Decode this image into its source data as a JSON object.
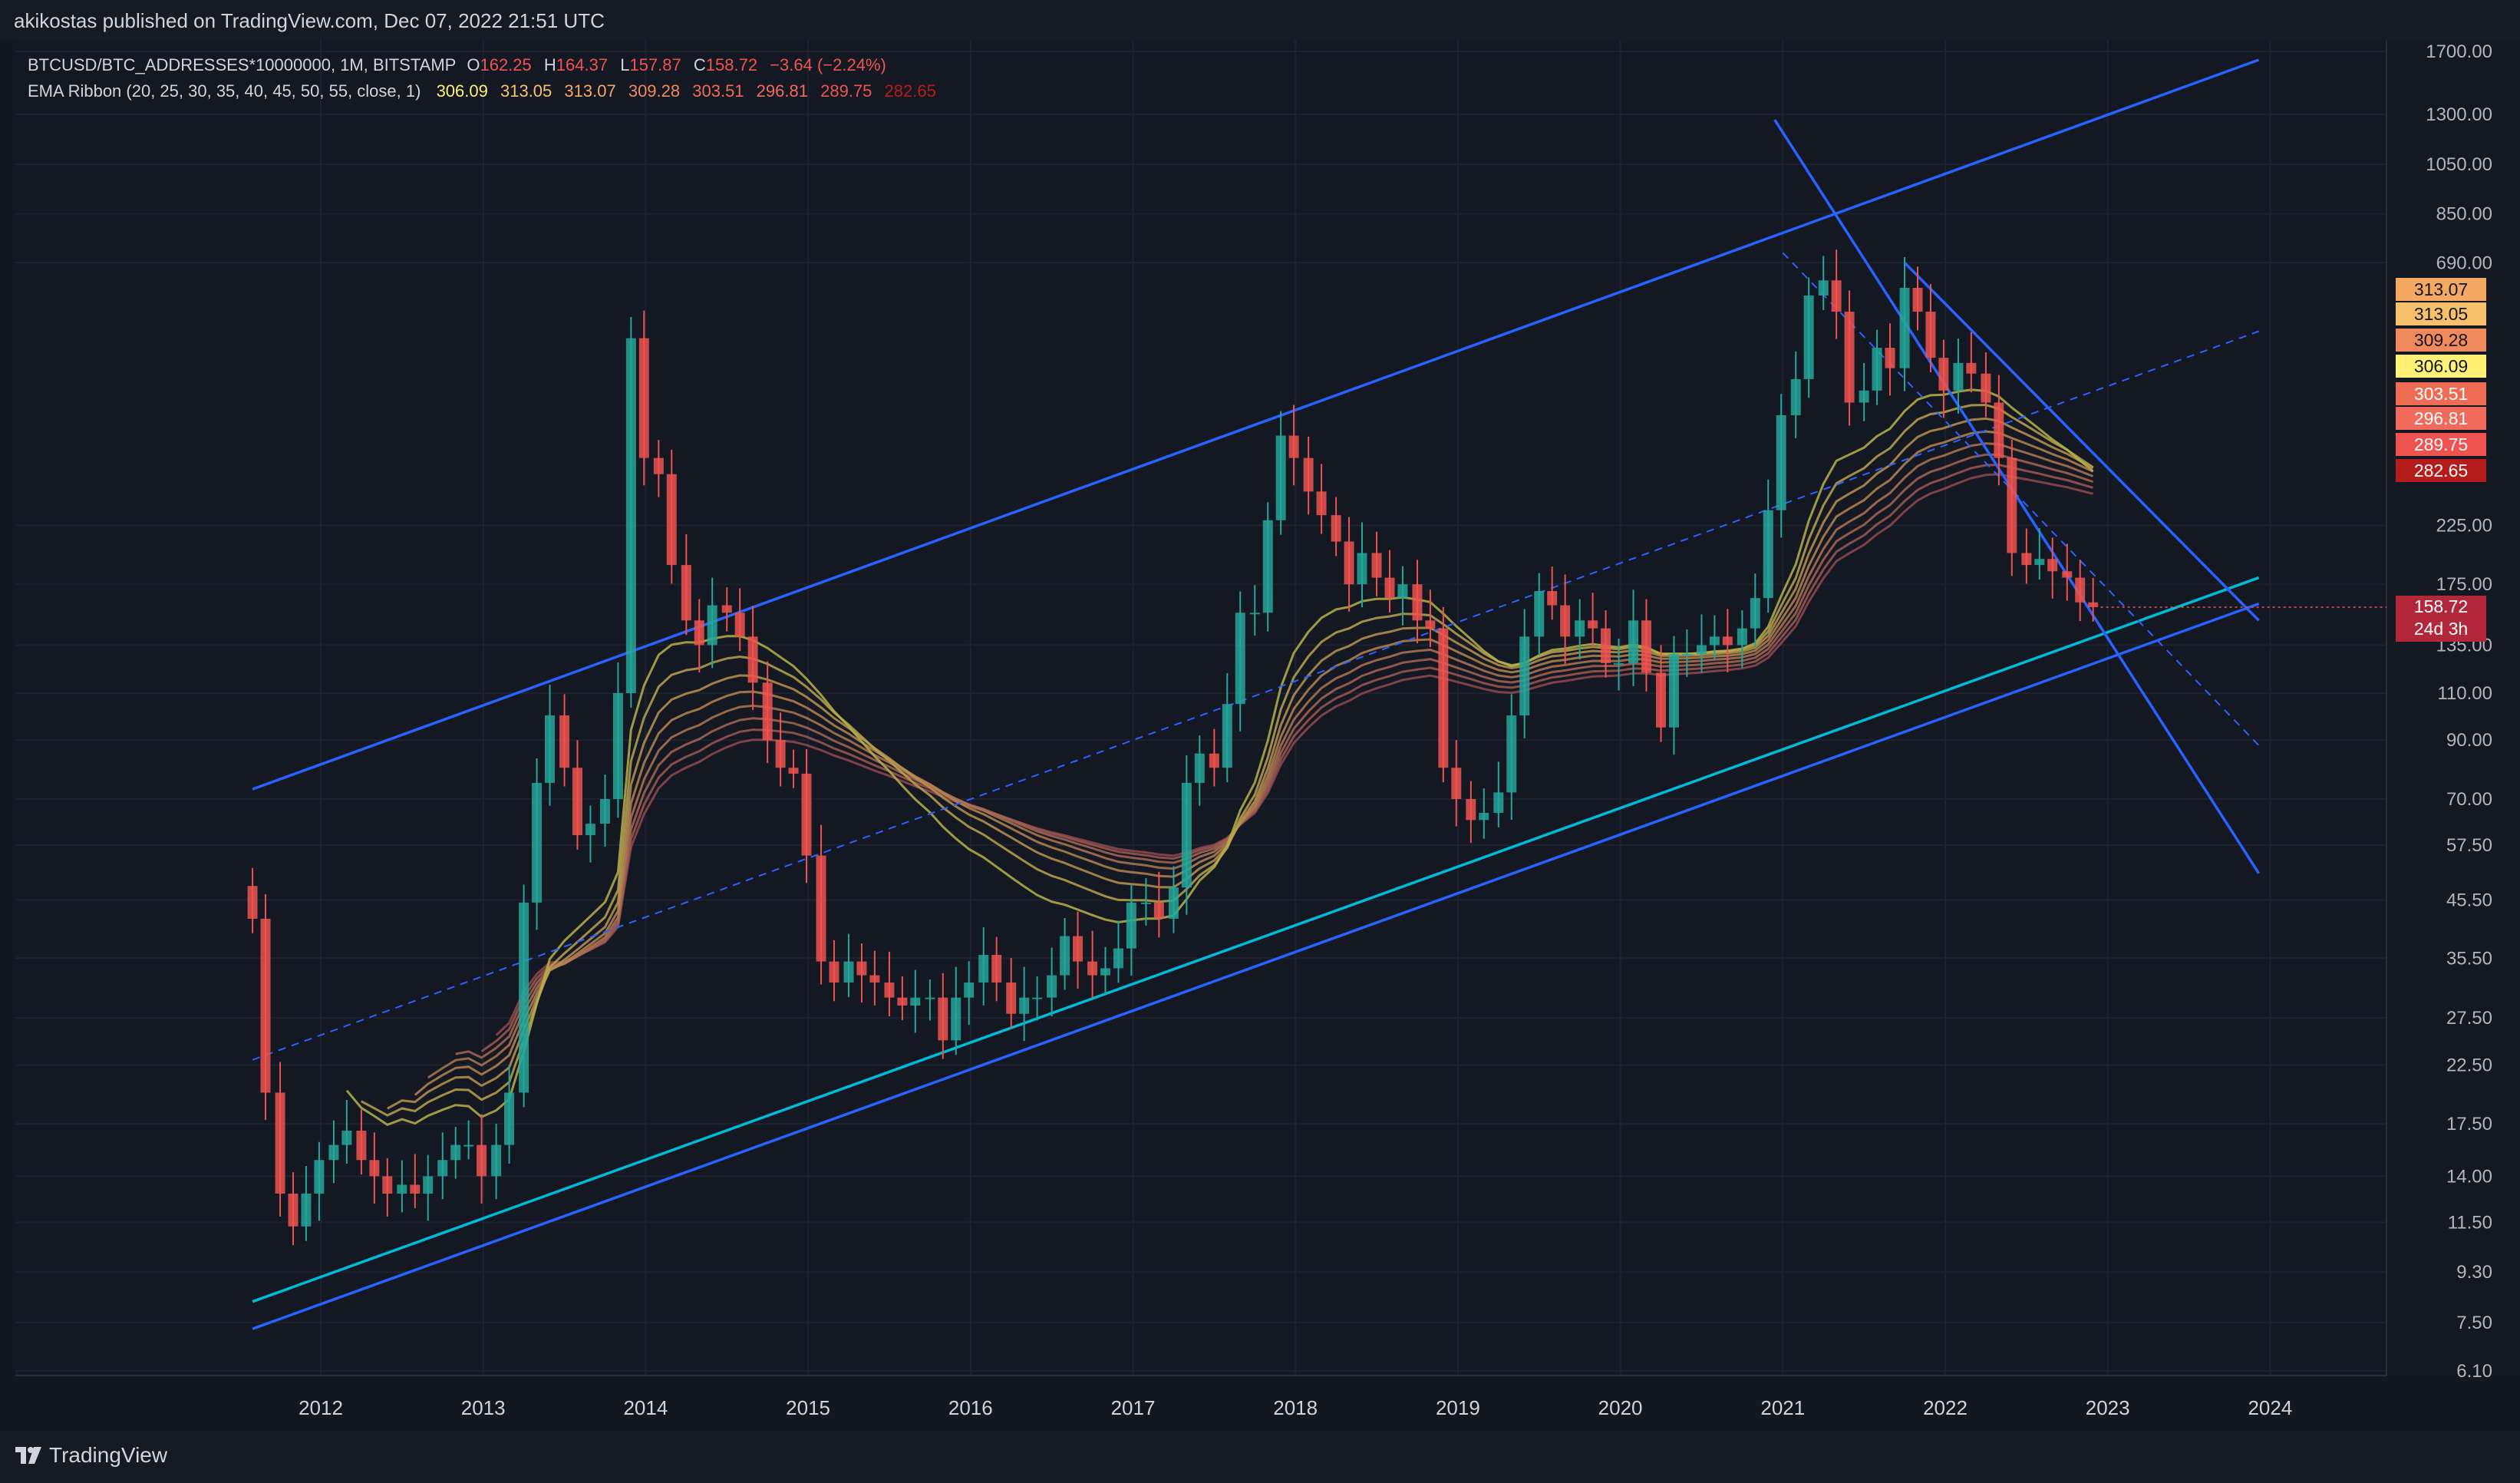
{
  "header": {
    "publisher": "akikostas published on TradingView.com, Dec 07, 2022 21:51 UTC"
  },
  "legend": {
    "symbol": "BTCUSD/BTC_ADDRESSES*10000000, 1M, BITSTAMP",
    "o_label": "O",
    "o_value": "162.25",
    "h_label": "H",
    "h_value": "164.37",
    "l_label": "L",
    "l_value": "157.87",
    "c_label": "C",
    "c_value": "158.72",
    "change": "−3.64 (−2.24%)",
    "ema_label": "EMA Ribbon (20, 25, 30, 35, 40, 45, 50, 55, close, 1)",
    "ema_values": [
      "306.09",
      "313.05",
      "313.07",
      "309.28",
      "303.51",
      "296.81",
      "289.75",
      "282.65"
    ]
  },
  "price_tags": [
    {
      "text": "313.07",
      "bg": "#f5a862",
      "fg": "#131722"
    },
    {
      "text": "313.05",
      "bg": "#f7c06a",
      "fg": "#131722"
    },
    {
      "text": "309.28",
      "bg": "#f08a5d",
      "fg": "#131722"
    },
    {
      "text": "306.09",
      "bg": "#fff176",
      "fg": "#131722"
    },
    {
      "text": "303.51",
      "bg": "#ef6c54",
      "fg": "#ffffff"
    },
    {
      "text": "296.81",
      "bg": "#f26a5c",
      "fg": "#ffffff"
    },
    {
      "text": "289.75",
      "bg": "#ef5350",
      "fg": "#ffffff"
    },
    {
      "text": "282.65",
      "bg": "#b71c1c",
      "fg": "#ffffff"
    }
  ],
  "last_price": {
    "text": "158.72",
    "countdown": "24d 3h",
    "bg": "#ef5350"
  },
  "colors": {
    "background": "#141823",
    "up": "#26a69a",
    "down": "#ef5350",
    "channel": "#2962ff",
    "support": "#00bcd4",
    "grid": "#1e2230"
  },
  "footer": {
    "brand": "TradingView"
  },
  "chart_data": {
    "type": "candlestick",
    "scale": "log",
    "ylim": [
      5.6,
      1780
    ],
    "xlim": [
      2011.0,
      2024.6
    ],
    "y_ticks": [
      "1700.00",
      "1300.00",
      "1050.00",
      "850.00",
      "690.00",
      "225.00",
      "175.00",
      "135.00",
      "110.00",
      "90.00",
      "70.00",
      "57.50",
      "45.50",
      "35.50",
      "27.50",
      "22.50",
      "17.50",
      "14.00",
      "11.50",
      "9.30",
      "7.50",
      "6.10"
    ],
    "x_ticks": [
      "2012",
      "2013",
      "2014",
      "2015",
      "2016",
      "2017",
      "2018",
      "2019",
      "2020",
      "2021",
      "2022",
      "2023",
      "2024"
    ],
    "grid": true,
    "closes": [
      [
        2011.58,
        42
      ],
      [
        2011.66,
        20
      ],
      [
        2011.75,
        13
      ],
      [
        2011.83,
        11.3
      ],
      [
        2011.91,
        13
      ],
      [
        2011.99,
        15
      ],
      [
        2012.08,
        16
      ],
      [
        2012.16,
        17
      ],
      [
        2012.25,
        15
      ],
      [
        2012.33,
        14
      ],
      [
        2012.41,
        13
      ],
      [
        2012.5,
        13.5
      ],
      [
        2012.58,
        13
      ],
      [
        2012.66,
        14
      ],
      [
        2012.75,
        15
      ],
      [
        2012.83,
        16
      ],
      [
        2012.91,
        16
      ],
      [
        2012.99,
        14
      ],
      [
        2013.08,
        16
      ],
      [
        2013.16,
        20
      ],
      [
        2013.25,
        45
      ],
      [
        2013.33,
        75
      ],
      [
        2013.41,
        100
      ],
      [
        2013.5,
        80
      ],
      [
        2013.58,
        60
      ],
      [
        2013.66,
        63
      ],
      [
        2013.75,
        70
      ],
      [
        2013.83,
        110
      ],
      [
        2013.91,
        500
      ],
      [
        2013.99,
        300
      ],
      [
        2014.08,
        280
      ],
      [
        2014.16,
        190
      ],
      [
        2014.25,
        150
      ],
      [
        2014.33,
        135
      ],
      [
        2014.41,
        160
      ],
      [
        2014.5,
        155
      ],
      [
        2014.58,
        140
      ],
      [
        2014.66,
        115
      ],
      [
        2014.75,
        90
      ],
      [
        2014.83,
        80
      ],
      [
        2014.91,
        78
      ],
      [
        2014.99,
        55
      ],
      [
        2015.08,
        35
      ],
      [
        2015.16,
        32
      ],
      [
        2015.25,
        35
      ],
      [
        2015.33,
        33
      ],
      [
        2015.41,
        32
      ],
      [
        2015.5,
        30
      ],
      [
        2015.58,
        29
      ],
      [
        2015.66,
        30
      ],
      [
        2015.75,
        30
      ],
      [
        2015.83,
        25
      ],
      [
        2015.91,
        30
      ],
      [
        2015.99,
        32
      ],
      [
        2016.08,
        36
      ],
      [
        2016.16,
        32
      ],
      [
        2016.25,
        28
      ],
      [
        2016.33,
        30
      ],
      [
        2016.41,
        30
      ],
      [
        2016.5,
        33
      ],
      [
        2016.58,
        39
      ],
      [
        2016.66,
        35
      ],
      [
        2016.75,
        33
      ],
      [
        2016.83,
        34
      ],
      [
        2016.91,
        37
      ],
      [
        2016.99,
        45
      ],
      [
        2017.08,
        45
      ],
      [
        2017.16,
        42
      ],
      [
        2017.25,
        48
      ],
      [
        2017.33,
        75
      ],
      [
        2017.41,
        85
      ],
      [
        2017.5,
        80
      ],
      [
        2017.58,
        105
      ],
      [
        2017.66,
        155
      ],
      [
        2017.75,
        155
      ],
      [
        2017.83,
        230
      ],
      [
        2017.91,
        330
      ],
      [
        2017.99,
        300
      ],
      [
        2018.08,
        260
      ],
      [
        2018.16,
        235
      ],
      [
        2018.25,
        210
      ],
      [
        2018.33,
        175
      ],
      [
        2018.41,
        200
      ],
      [
        2018.5,
        180
      ],
      [
        2018.58,
        165
      ],
      [
        2018.66,
        175
      ],
      [
        2018.75,
        150
      ],
      [
        2018.83,
        145
      ],
      [
        2018.91,
        80
      ],
      [
        2018.99,
        70
      ],
      [
        2019.08,
        64
      ],
      [
        2019.16,
        66
      ],
      [
        2019.25,
        72
      ],
      [
        2019.33,
        100
      ],
      [
        2019.41,
        140
      ],
      [
        2019.5,
        170
      ],
      [
        2019.58,
        160
      ],
      [
        2019.66,
        140
      ],
      [
        2019.75,
        150
      ],
      [
        2019.83,
        145
      ],
      [
        2019.91,
        125
      ],
      [
        2019.99,
        125
      ],
      [
        2020.08,
        150
      ],
      [
        2020.16,
        120
      ],
      [
        2020.25,
        95
      ],
      [
        2020.33,
        130
      ],
      [
        2020.41,
        130
      ],
      [
        2020.5,
        135
      ],
      [
        2020.58,
        140
      ],
      [
        2020.66,
        135
      ],
      [
        2020.75,
        145
      ],
      [
        2020.83,
        165
      ],
      [
        2020.91,
        240
      ],
      [
        2020.99,
        360
      ],
      [
        2021.08,
        420
      ],
      [
        2021.16,
        600
      ],
      [
        2021.25,
        640
      ],
      [
        2021.33,
        560
      ],
      [
        2021.41,
        380
      ],
      [
        2021.5,
        400
      ],
      [
        2021.58,
        480
      ],
      [
        2021.66,
        440
      ],
      [
        2021.75,
        620
      ],
      [
        2021.83,
        560
      ],
      [
        2021.91,
        460
      ],
      [
        2021.99,
        400
      ],
      [
        2022.08,
        450
      ],
      [
        2022.16,
        430
      ],
      [
        2022.25,
        380
      ],
      [
        2022.33,
        300
      ],
      [
        2022.41,
        200
      ],
      [
        2022.5,
        190
      ],
      [
        2022.58,
        195
      ],
      [
        2022.66,
        185
      ],
      [
        2022.75,
        180
      ],
      [
        2022.83,
        162
      ],
      [
        2022.91,
        158.72
      ]
    ],
    "ema_ribbon": {
      "periods": [
        20,
        25,
        30,
        35,
        40,
        45,
        50,
        55
      ],
      "last_values": [
        306.09,
        313.05,
        313.07,
        309.28,
        303.51,
        296.81,
        289.75,
        282.65
      ]
    },
    "trendlines": [
      {
        "name": "Channel Top",
        "points": [
          [
            2011.58,
            73
          ],
          [
            2023.93,
            1640
          ]
        ]
      },
      {
        "name": "Channel Bottom",
        "points": [
          [
            2011.58,
            7.3
          ],
          [
            2023.93,
            161
          ]
        ]
      },
      {
        "name": "Support",
        "points": [
          [
            2011.58,
            8.2
          ],
          [
            2023.93,
            180
          ]
        ]
      },
      {
        "name": "Channel Mid",
        "dashed": true,
        "points": [
          [
            2011.58,
            23
          ],
          [
            2023.93,
            515
          ]
        ]
      },
      {
        "name": "Down Channel Upper",
        "points": [
          [
            2021.75,
            690
          ],
          [
            2023.93,
            150
          ]
        ]
      },
      {
        "name": "Down Channel Lower",
        "points": [
          [
            2020.95,
            1270
          ],
          [
            2023.93,
            51
          ]
        ]
      },
      {
        "name": "Down Channel Mid",
        "dashed": true,
        "points": [
          [
            2021.0,
            720
          ],
          [
            2023.93,
            88
          ]
        ]
      }
    ]
  }
}
